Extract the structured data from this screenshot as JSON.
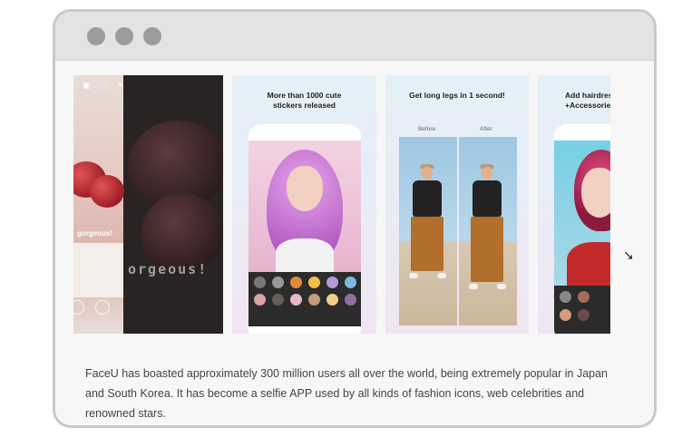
{
  "window": {
    "controls": [
      "dot",
      "dot",
      "dot"
    ]
  },
  "gallery": {
    "screenshots": [
      {
        "id": "dessert",
        "caption_small": "gorgeous!",
        "caption_large": "orgeous!"
      },
      {
        "id": "stickers",
        "title": "More than 1000 cute stickers released"
      },
      {
        "id": "legs",
        "title": "Get long legs in 1 second!",
        "before_label": "Before",
        "after_label": "After"
      },
      {
        "id": "hairdress",
        "title_line1": "Add hairdress",
        "title_line2": "+Accessories"
      }
    ]
  },
  "description": "FaceU has boasted approximately 300 million users all over the world, being extremely popular in Japan and South Korea. It has become a selfie APP used by all kinds of fashion icons, web celebrities and renowned stars.",
  "colors": {
    "window_border": "#c9c9c9",
    "titlebar": "#e3e3e3",
    "dot": "#9c9c9c",
    "text": "#444444"
  }
}
